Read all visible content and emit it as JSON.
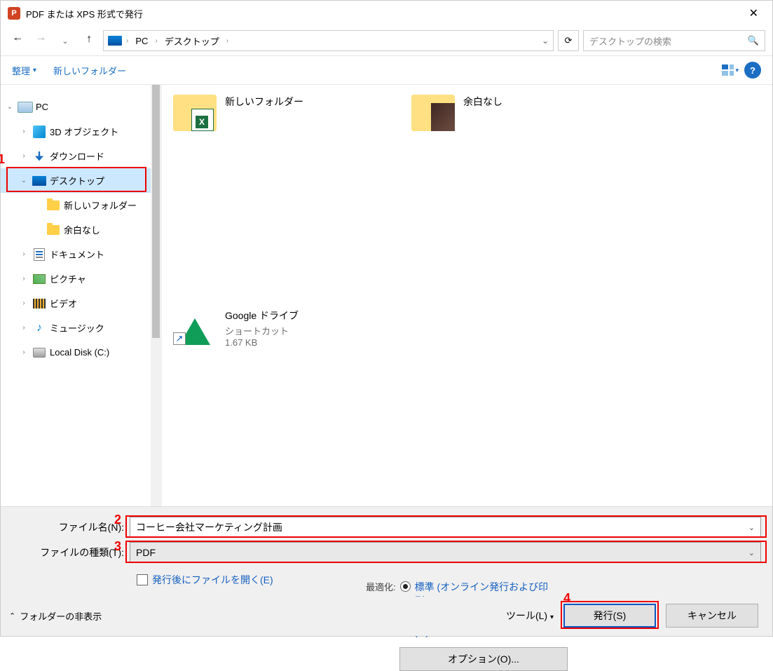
{
  "window": {
    "title": "PDF または XPS 形式で発行"
  },
  "nav": {
    "breadcrumbs": [
      "PC",
      "デスクトップ"
    ],
    "search_placeholder": "デスクトップの検索"
  },
  "toolbar": {
    "organize": "整理",
    "new_folder": "新しいフォルダー"
  },
  "tree": {
    "pc": "PC",
    "objects3d": "3D オブジェクト",
    "downloads": "ダウンロード",
    "desktop": "デスクトップ",
    "new_folder": "新しいフォルダー",
    "no_margin": "余白なし",
    "documents": "ドキュメント",
    "pictures": "ピクチャ",
    "videos": "ビデオ",
    "music": "ミュージック",
    "local_disk": "Local Disk (C:)"
  },
  "files": [
    {
      "name": "新しいフォルダー",
      "type": "",
      "size": ""
    },
    {
      "name": "余白なし",
      "type": "",
      "size": ""
    },
    {
      "name": "Google ドライブ",
      "type": "ショートカット",
      "size": "1.67 KB"
    }
  ],
  "fields": {
    "filename_label": "ファイル名(N):",
    "filename_value": "コーヒー会社マーケティング計画",
    "filetype_label": "ファイルの種類(T):",
    "filetype_value": "PDF"
  },
  "options": {
    "open_after_label": "発行後にファイルを開く(E)",
    "optimize_label": "最適化:",
    "standard_label": "標準 (オンライン発行および印刷)(A)",
    "minimum_label": "最小サイズ (オンライン発行)(M)",
    "options_button": "オプション(O)..."
  },
  "footer": {
    "hide_folders": "フォルダーの非表示",
    "tools": "ツール(L)",
    "publish": "発行(S)",
    "cancel": "キャンセル"
  },
  "annotations": [
    "1",
    "2",
    "3",
    "4"
  ]
}
